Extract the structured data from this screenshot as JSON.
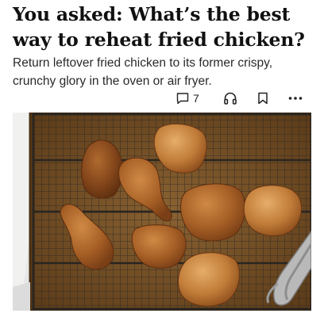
{
  "article": {
    "headline": "You asked: What’s the best way to reheat fried chicken?",
    "dek": "Return leftover fried chicken to its former crispy, crunchy glory in the oven or air fryer."
  },
  "actions": {
    "comment_icon": "comment-icon",
    "comment_count": "7",
    "listen_icon": "headphones-icon",
    "save_icon": "bookmark-icon",
    "more_icon": "more-dots-icon"
  },
  "image": {
    "subject": "fried-chicken-on-wire-rack",
    "colors": {
      "tray": "#6e4a22",
      "rack": "#2f2a24",
      "chicken": "#a8642a",
      "background": "#e7e7e7"
    }
  }
}
